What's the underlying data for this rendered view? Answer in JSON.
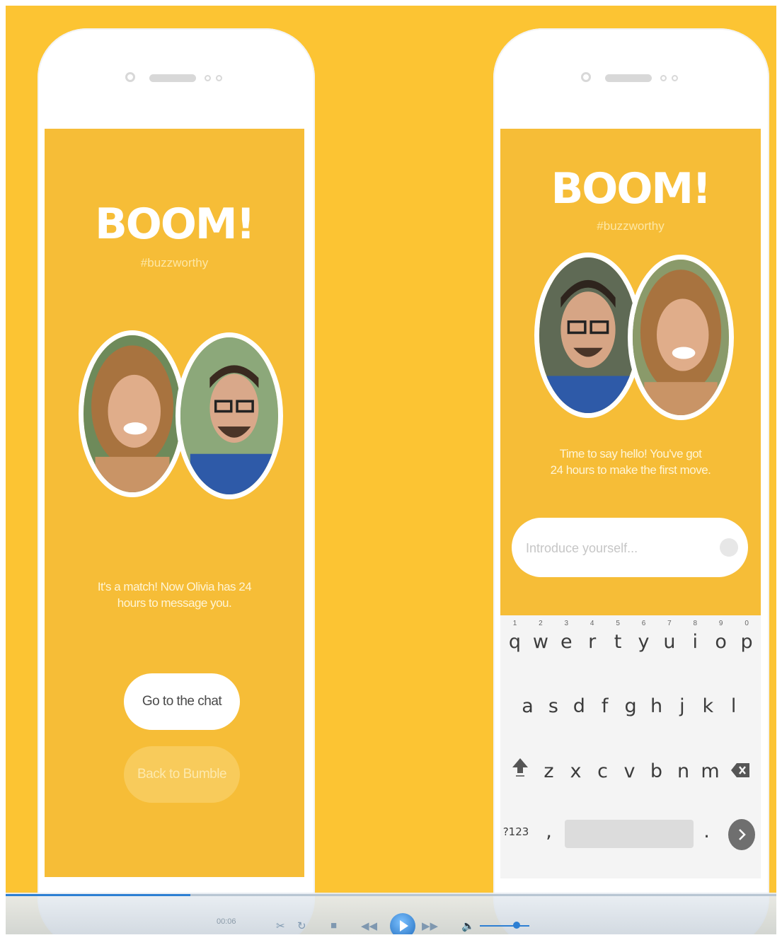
{
  "left_screen": {
    "title": "BOOM!",
    "hashtag": "#buzzworthy",
    "message_line1": "It's a match! Now Olivia has 24",
    "message_line2": "hours to message you.",
    "primary_button": "Go to the chat",
    "secondary_button": "Back to Bumble"
  },
  "right_screen": {
    "title": "BOOM!",
    "hashtag": "#buzzworthy",
    "message_line1": "Time to say hello! You've got",
    "message_line2": "24 hours to make the first move.",
    "input_placeholder": "Introduce yourself...",
    "keyboard": {
      "numbers": [
        "1",
        "2",
        "3",
        "4",
        "5",
        "6",
        "7",
        "8",
        "9",
        "0"
      ],
      "row1": [
        "q",
        "w",
        "e",
        "r",
        "t",
        "y",
        "u",
        "i",
        "o",
        "p"
      ],
      "row2": [
        "a",
        "s",
        "d",
        "f",
        "g",
        "h",
        "j",
        "k",
        "l"
      ],
      "row3": [
        "z",
        "x",
        "c",
        "v",
        "b",
        "n",
        "m"
      ],
      "symbols_key": "?123",
      "comma_key": ",",
      "period_key": "."
    }
  },
  "player": {
    "time": "00:06",
    "progress_fraction": 0.24
  },
  "colors": {
    "background": "#fcc433",
    "screen": "#f6bd37",
    "button_primary": "#ffffff",
    "button_secondary": "#f8cb5b",
    "accent_blue": "#2d7fd3"
  },
  "icons": [
    "camera-icon",
    "speaker-icon",
    "send-icon",
    "shift-icon",
    "backspace-icon",
    "enter-icon",
    "cut-icon",
    "repeat-icon",
    "stop-icon",
    "rewind-icon",
    "play-icon",
    "fast-forward-icon",
    "volume-icon"
  ]
}
